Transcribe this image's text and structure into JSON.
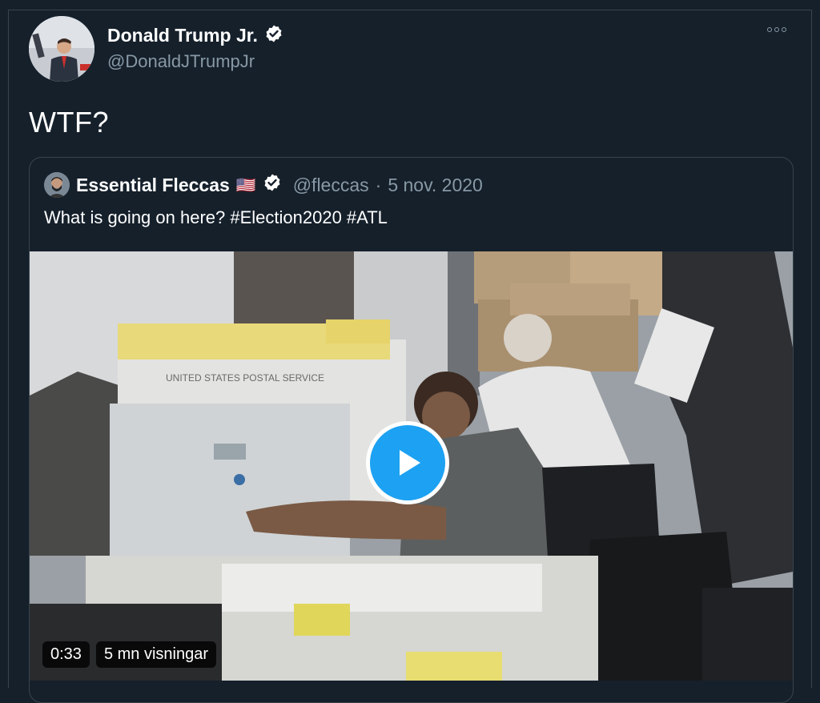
{
  "tweet": {
    "author_name": "Donald Trump Jr.",
    "author_handle": "@DonaldJTrumpJr",
    "text": "WTF?",
    "more_icon": "more-horizontal-icon",
    "verified_icon": "verified-badge-icon"
  },
  "quoted": {
    "author_name": "Essential Fleccas",
    "flag": "🇺🇸",
    "author_handle": "@fleccas",
    "separator": "·",
    "date": "5 nov. 2020",
    "text": "What is going on here? #Election2020 #ATL",
    "video": {
      "duration": "0:33",
      "views": "5 mn visningar",
      "play_icon": "play-icon",
      "box_text": "UNITED STATES POSTAL SERVICE"
    }
  },
  "colors": {
    "background": "#15202b",
    "border": "#38444d",
    "muted_text": "#8899a6",
    "accent": "#1da1f2"
  }
}
